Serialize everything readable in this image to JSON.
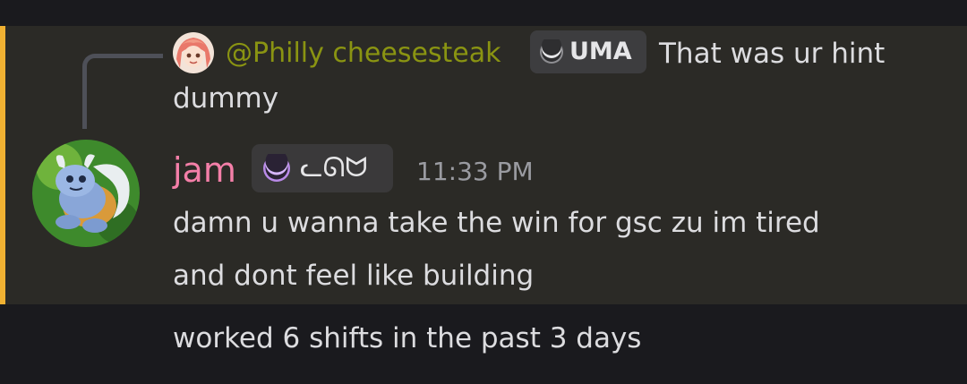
{
  "colors": {
    "background": "#1a1a1e",
    "mention_highlight": "#2b2a26",
    "mention_bar": "#f0b132",
    "reply_author_color": "#8a9412",
    "author_color": "#f47fa8",
    "text_color": "#dcdcdf",
    "timestamp_color": "#9a9ba1"
  },
  "reply": {
    "avatar_icon": "anime-girl-avatar",
    "author": "@Philly cheesesteak",
    "tag_icon": "crescent-moon-icon",
    "tag_label": "UMA",
    "text_line_1": "That was ur hint",
    "text_line_2": "dummy"
  },
  "message": {
    "avatar_icon": "wartortle-avatar",
    "author": "jam",
    "tag_icon": "crescent-moon-icon",
    "tag_label": "ᓚᘏᗢ",
    "timestamp": "11:33 PM",
    "lines": [
      "damn u wanna take the win for gsc zu im tired",
      "and dont feel like building"
    ]
  },
  "followup": {
    "text": "worked 6 shifts in the past 3 days"
  }
}
